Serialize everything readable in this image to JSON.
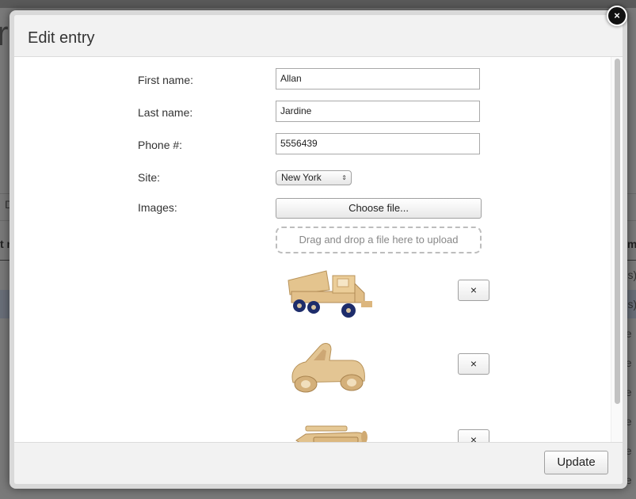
{
  "background": {
    "heading_fragment": "r",
    "tab_fragment": "D",
    "column_header_left": "t n",
    "column_header_right": "Im",
    "cells": [
      "e(s)",
      "e(s)",
      "ge",
      "ge",
      "ge",
      "ge",
      "ge",
      "ge"
    ]
  },
  "modal": {
    "title": "Edit entry",
    "close_label": "×",
    "form": {
      "first_name_label": "First name:",
      "first_name_value": "Allan",
      "last_name_label": "Last name:",
      "last_name_value": "Jardine",
      "phone_label": "Phone #:",
      "phone_value": "5556439",
      "site_label": "Site:",
      "site_selected": "New York",
      "images_label": "Images:",
      "choose_file_label": "Choose file...",
      "drop_zone_text": "Drag and drop a file here to upload"
    },
    "images": [
      {
        "icon": "toy-dump-truck-image",
        "remove_label": "×"
      },
      {
        "icon": "toy-car-image",
        "remove_label": "×"
      },
      {
        "icon": "toy-airplane-image",
        "remove_label": "×"
      }
    ],
    "footer": {
      "update_label": "Update"
    }
  },
  "colors": {
    "overlay": "#7a7a7a",
    "modal_frame": "#d9d9d9",
    "header_footer_bg": "#f2f2f2",
    "wood": "#e2c38e",
    "wheel_dark": "#1d2c6b"
  }
}
